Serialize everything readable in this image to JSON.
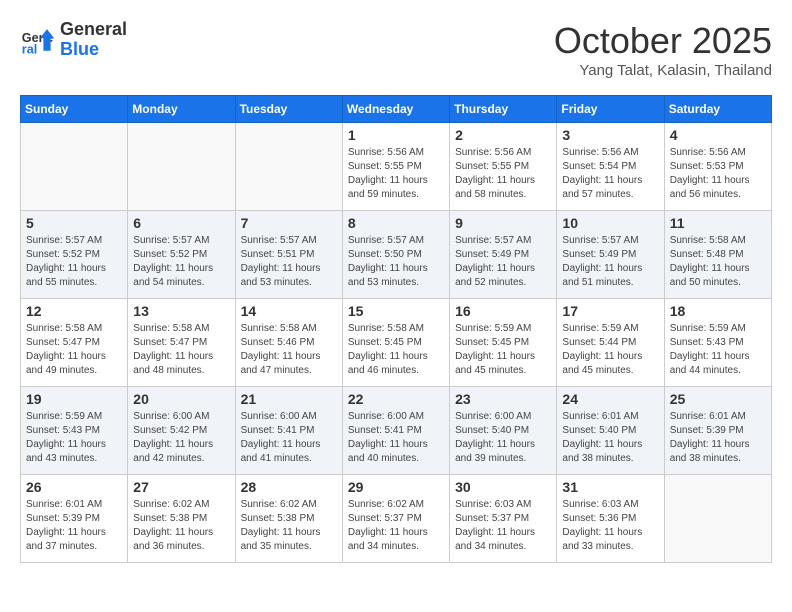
{
  "header": {
    "logo_line1": "General",
    "logo_line2": "Blue",
    "month": "October 2025",
    "location": "Yang Talat, Kalasin, Thailand"
  },
  "weekdays": [
    "Sunday",
    "Monday",
    "Tuesday",
    "Wednesday",
    "Thursday",
    "Friday",
    "Saturday"
  ],
  "weeks": [
    {
      "shaded": false,
      "days": [
        {
          "num": "",
          "info": ""
        },
        {
          "num": "",
          "info": ""
        },
        {
          "num": "",
          "info": ""
        },
        {
          "num": "1",
          "info": "Sunrise: 5:56 AM\nSunset: 5:55 PM\nDaylight: 11 hours\nand 59 minutes."
        },
        {
          "num": "2",
          "info": "Sunrise: 5:56 AM\nSunset: 5:55 PM\nDaylight: 11 hours\nand 58 minutes."
        },
        {
          "num": "3",
          "info": "Sunrise: 5:56 AM\nSunset: 5:54 PM\nDaylight: 11 hours\nand 57 minutes."
        },
        {
          "num": "4",
          "info": "Sunrise: 5:56 AM\nSunset: 5:53 PM\nDaylight: 11 hours\nand 56 minutes."
        }
      ]
    },
    {
      "shaded": true,
      "days": [
        {
          "num": "5",
          "info": "Sunrise: 5:57 AM\nSunset: 5:52 PM\nDaylight: 11 hours\nand 55 minutes."
        },
        {
          "num": "6",
          "info": "Sunrise: 5:57 AM\nSunset: 5:52 PM\nDaylight: 11 hours\nand 54 minutes."
        },
        {
          "num": "7",
          "info": "Sunrise: 5:57 AM\nSunset: 5:51 PM\nDaylight: 11 hours\nand 53 minutes."
        },
        {
          "num": "8",
          "info": "Sunrise: 5:57 AM\nSunset: 5:50 PM\nDaylight: 11 hours\nand 53 minutes."
        },
        {
          "num": "9",
          "info": "Sunrise: 5:57 AM\nSunset: 5:49 PM\nDaylight: 11 hours\nand 52 minutes."
        },
        {
          "num": "10",
          "info": "Sunrise: 5:57 AM\nSunset: 5:49 PM\nDaylight: 11 hours\nand 51 minutes."
        },
        {
          "num": "11",
          "info": "Sunrise: 5:58 AM\nSunset: 5:48 PM\nDaylight: 11 hours\nand 50 minutes."
        }
      ]
    },
    {
      "shaded": false,
      "days": [
        {
          "num": "12",
          "info": "Sunrise: 5:58 AM\nSunset: 5:47 PM\nDaylight: 11 hours\nand 49 minutes."
        },
        {
          "num": "13",
          "info": "Sunrise: 5:58 AM\nSunset: 5:47 PM\nDaylight: 11 hours\nand 48 minutes."
        },
        {
          "num": "14",
          "info": "Sunrise: 5:58 AM\nSunset: 5:46 PM\nDaylight: 11 hours\nand 47 minutes."
        },
        {
          "num": "15",
          "info": "Sunrise: 5:58 AM\nSunset: 5:45 PM\nDaylight: 11 hours\nand 46 minutes."
        },
        {
          "num": "16",
          "info": "Sunrise: 5:59 AM\nSunset: 5:45 PM\nDaylight: 11 hours\nand 45 minutes."
        },
        {
          "num": "17",
          "info": "Sunrise: 5:59 AM\nSunset: 5:44 PM\nDaylight: 11 hours\nand 45 minutes."
        },
        {
          "num": "18",
          "info": "Sunrise: 5:59 AM\nSunset: 5:43 PM\nDaylight: 11 hours\nand 44 minutes."
        }
      ]
    },
    {
      "shaded": true,
      "days": [
        {
          "num": "19",
          "info": "Sunrise: 5:59 AM\nSunset: 5:43 PM\nDaylight: 11 hours\nand 43 minutes."
        },
        {
          "num": "20",
          "info": "Sunrise: 6:00 AM\nSunset: 5:42 PM\nDaylight: 11 hours\nand 42 minutes."
        },
        {
          "num": "21",
          "info": "Sunrise: 6:00 AM\nSunset: 5:41 PM\nDaylight: 11 hours\nand 41 minutes."
        },
        {
          "num": "22",
          "info": "Sunrise: 6:00 AM\nSunset: 5:41 PM\nDaylight: 11 hours\nand 40 minutes."
        },
        {
          "num": "23",
          "info": "Sunrise: 6:00 AM\nSunset: 5:40 PM\nDaylight: 11 hours\nand 39 minutes."
        },
        {
          "num": "24",
          "info": "Sunrise: 6:01 AM\nSunset: 5:40 PM\nDaylight: 11 hours\nand 38 minutes."
        },
        {
          "num": "25",
          "info": "Sunrise: 6:01 AM\nSunset: 5:39 PM\nDaylight: 11 hours\nand 38 minutes."
        }
      ]
    },
    {
      "shaded": false,
      "days": [
        {
          "num": "26",
          "info": "Sunrise: 6:01 AM\nSunset: 5:39 PM\nDaylight: 11 hours\nand 37 minutes."
        },
        {
          "num": "27",
          "info": "Sunrise: 6:02 AM\nSunset: 5:38 PM\nDaylight: 11 hours\nand 36 minutes."
        },
        {
          "num": "28",
          "info": "Sunrise: 6:02 AM\nSunset: 5:38 PM\nDaylight: 11 hours\nand 35 minutes."
        },
        {
          "num": "29",
          "info": "Sunrise: 6:02 AM\nSunset: 5:37 PM\nDaylight: 11 hours\nand 34 minutes."
        },
        {
          "num": "30",
          "info": "Sunrise: 6:03 AM\nSunset: 5:37 PM\nDaylight: 11 hours\nand 34 minutes."
        },
        {
          "num": "31",
          "info": "Sunrise: 6:03 AM\nSunset: 5:36 PM\nDaylight: 11 hours\nand 33 minutes."
        },
        {
          "num": "",
          "info": ""
        }
      ]
    }
  ]
}
